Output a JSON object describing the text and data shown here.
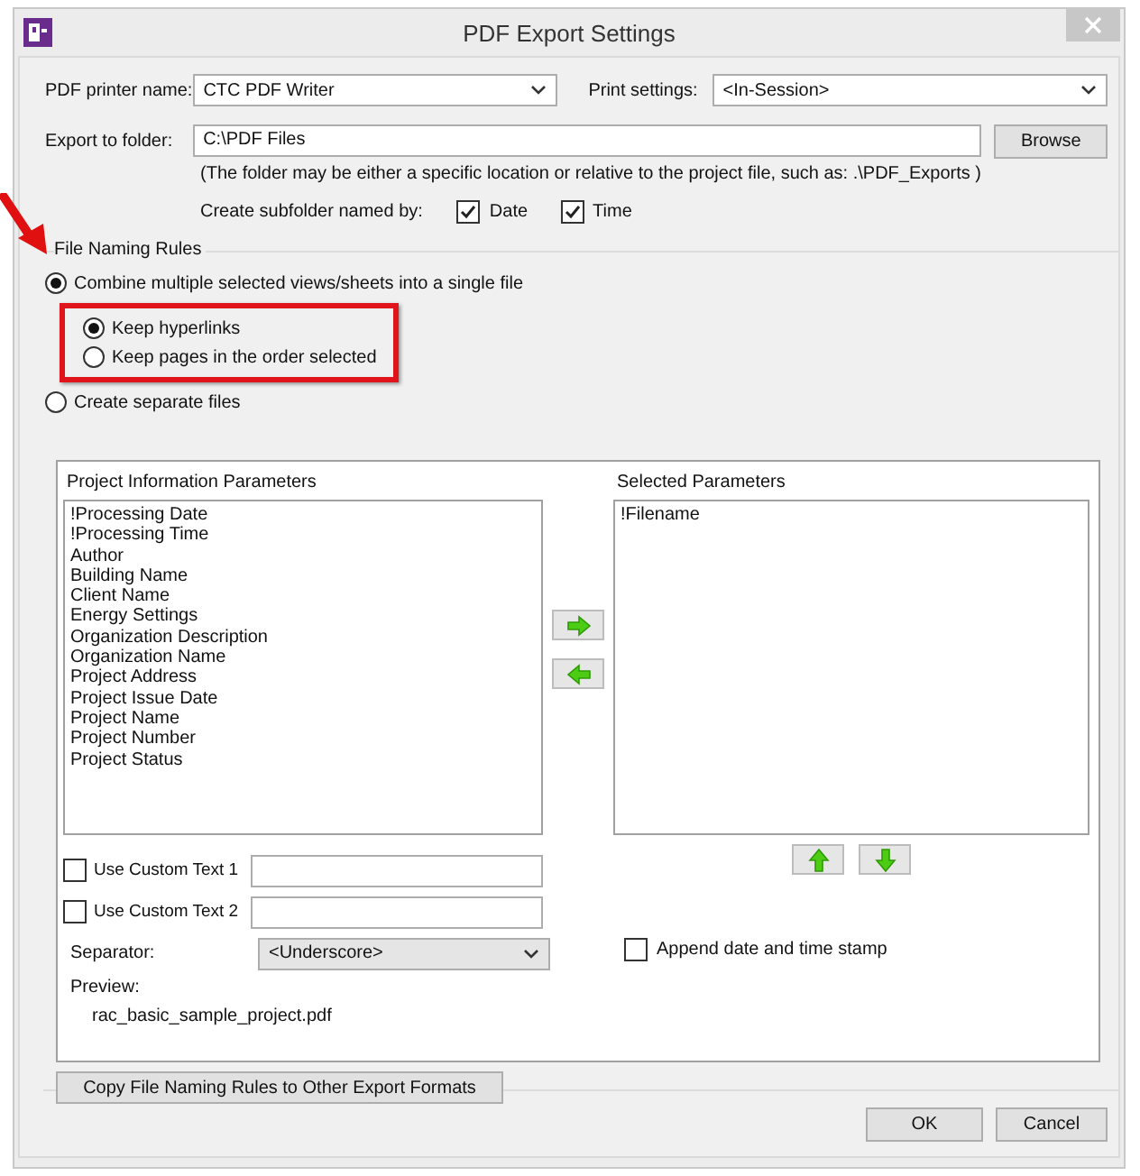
{
  "window": {
    "title": "PDF Export Settings"
  },
  "printer": {
    "label": "PDF printer name:",
    "value": "CTC PDF Writer"
  },
  "print_settings": {
    "label": "Print settings:",
    "value": "<In-Session>"
  },
  "folder": {
    "label": "Export to folder:",
    "value": "C:\\PDF Files",
    "button": "Browse",
    "note": "(The folder may be either a specific location or relative to the project file, such as:  .\\PDF_Exports )"
  },
  "subfolder": {
    "label": "Create subfolder named by:",
    "options": [
      {
        "label": "Date",
        "checked": true
      },
      {
        "label": "Time",
        "checked": true
      }
    ]
  },
  "naming": {
    "title": "File Naming Rules",
    "modes": [
      {
        "label": "Combine multiple selected views/sheets into a single file",
        "selected": true,
        "sub_options": [
          {
            "label": "Keep hyperlinks",
            "selected": true
          },
          {
            "label": "Keep pages in the order selected",
            "selected": false
          }
        ]
      },
      {
        "label": "Create separate files",
        "selected": false
      }
    ],
    "project_parameters": {
      "title": "Project Information Parameters",
      "items": [
        "!Processing Date",
        "!Processing Time",
        "Author",
        "Building Name",
        "Client Name",
        "Energy Settings",
        "Organization Description",
        "Organization Name",
        "Project Address",
        "Project Issue Date",
        "Project Name",
        "Project Number",
        "Project Status"
      ]
    },
    "selected_parameters": {
      "title": "Selected Parameters",
      "items": [
        "!Filename"
      ]
    },
    "custom_texts": [
      {
        "label": "Use Custom Text 1",
        "checked": false
      },
      {
        "label": "Use Custom Text 2",
        "checked": false
      }
    ],
    "separator": {
      "label": "Separator:",
      "value": "<Underscore>"
    },
    "append_timestamp": {
      "label": "Append date and time stamp",
      "checked": false
    },
    "preview": {
      "label": "Preview:",
      "value": "rac_basic_sample_project.pdf"
    },
    "copy_button": "Copy File Naming Rules to Other Export Formats"
  },
  "buttons": [
    "OK",
    "Cancel"
  ]
}
